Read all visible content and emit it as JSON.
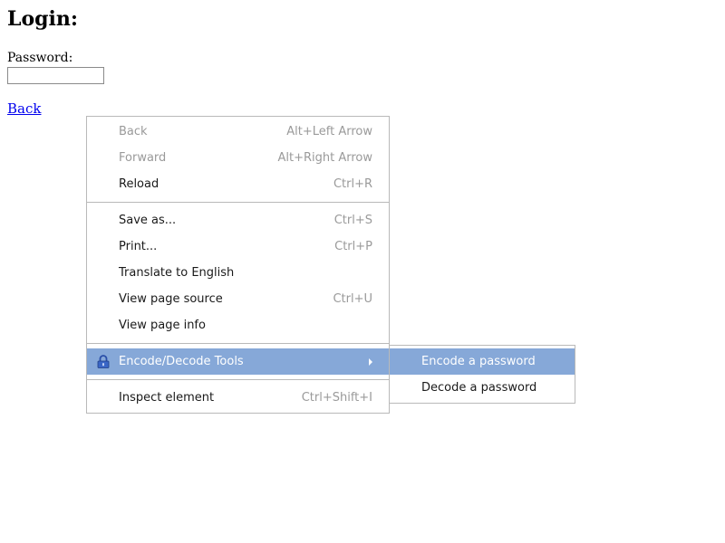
{
  "page": {
    "title": "Login:",
    "password_label": "Password:",
    "password_value": "",
    "back_link": "Back"
  },
  "context_menu": {
    "items": [
      {
        "label": "Back",
        "shortcut": "Alt+Left Arrow",
        "enabled": false
      },
      {
        "label": "Forward",
        "shortcut": "Alt+Right Arrow",
        "enabled": false
      },
      {
        "label": "Reload",
        "shortcut": "Ctrl+R",
        "enabled": true
      },
      {
        "label": "Save as...",
        "shortcut": "Ctrl+S",
        "enabled": true
      },
      {
        "label": "Print...",
        "shortcut": "Ctrl+P",
        "enabled": true
      },
      {
        "label": "Translate to English",
        "shortcut": "",
        "enabled": true
      },
      {
        "label": "View page source",
        "shortcut": "Ctrl+U",
        "enabled": true
      },
      {
        "label": "View page info",
        "shortcut": "",
        "enabled": true
      },
      {
        "label": "Encode/Decode Tools",
        "shortcut": "",
        "enabled": true,
        "highlighted": true,
        "icon": "lock-icon",
        "has_submenu": true
      },
      {
        "label": "Inspect element",
        "shortcut": "Ctrl+Shift+I",
        "enabled": true
      }
    ]
  },
  "submenu": {
    "items": [
      {
        "label": "Encode a password",
        "highlighted": true
      },
      {
        "label": "Decode a password",
        "highlighted": false
      }
    ]
  },
  "colors": {
    "highlight": "#86a8d8",
    "link": "#0000ee",
    "disabled_text": "#9a9a9a",
    "menu_border": "#b9b9b9"
  }
}
